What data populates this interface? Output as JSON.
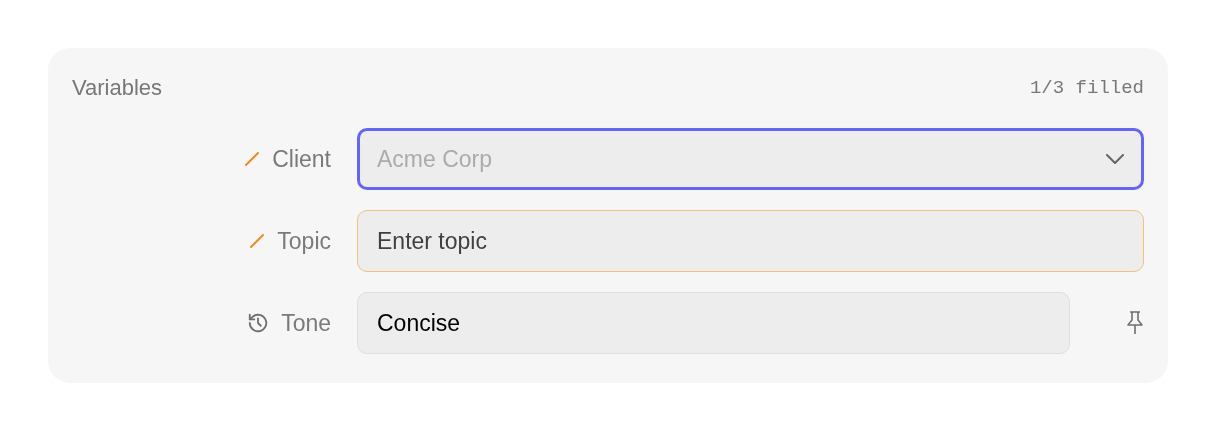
{
  "panel": {
    "title": "Variables",
    "filled_count": "1/3 filled"
  },
  "variables": [
    {
      "label": "Client",
      "kind": "select",
      "filled": false,
      "focused": true,
      "pinnable": false,
      "placeholder": "Acme Corp"
    },
    {
      "label": "Topic",
      "kind": "text",
      "filled": false,
      "focused": false,
      "pinnable": false,
      "placeholder": "Enter topic"
    },
    {
      "label": "Tone",
      "kind": "text",
      "filled": true,
      "focused": false,
      "pinnable": true,
      "value": "Concise"
    }
  ]
}
